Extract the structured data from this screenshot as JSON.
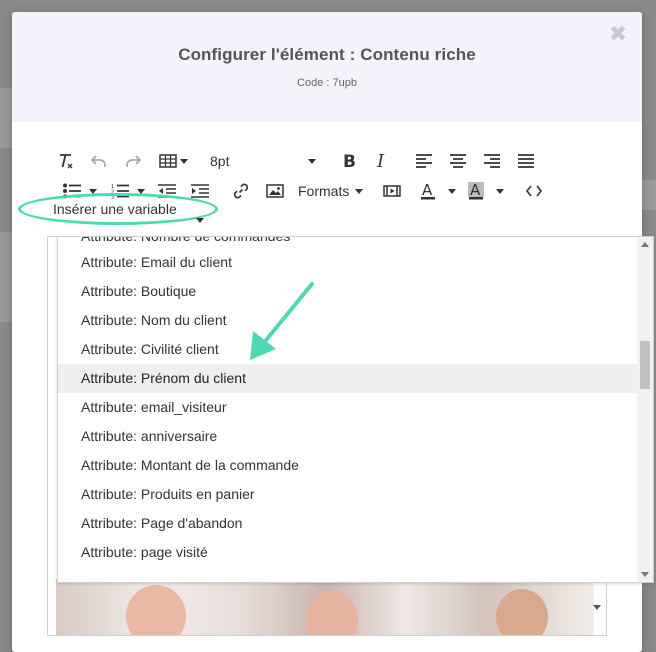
{
  "modal": {
    "title": "Configurer l'élément : Contenu riche",
    "code": "Code : 7upb",
    "close_glyph": "✖"
  },
  "toolbar": {
    "font_size": "8pt",
    "formats_label": "Formats",
    "insert_variable_label": "Insérer une variable",
    "icons": [
      "clear-format-icon",
      "undo-icon",
      "redo-icon",
      "table-icon",
      "bold-icon",
      "italic-icon",
      "align-left-icon",
      "align-center-icon",
      "align-right-icon",
      "align-justify-icon",
      "bullet-list-icon",
      "numbered-list-icon",
      "outdent-icon",
      "indent-icon",
      "link-icon",
      "image-icon",
      "media-icon",
      "text-color-icon",
      "background-color-icon",
      "source-code-icon"
    ],
    "text_color": "#333333",
    "bg_color": "#888888"
  },
  "dropdown": {
    "items": [
      {
        "label": "Attribute: Nombre de commandes"
      },
      {
        "label": "Attribute: Email du client"
      },
      {
        "label": "Attribute: Boutique"
      },
      {
        "label": "Attribute: Nom du client"
      },
      {
        "label": "Attribute: Civilité client"
      },
      {
        "label": "Attribute: Prénom du client"
      },
      {
        "label": "Attribute: email_visiteur"
      },
      {
        "label": "Attribute: anniversaire"
      },
      {
        "label": "Attribute: Montant de la commande"
      },
      {
        "label": "Attribute: Produits en panier"
      },
      {
        "label": "Attribute: Page d'abandon"
      },
      {
        "label": "Attribute: page visité"
      }
    ],
    "highlighted_index": 5
  },
  "colors": {
    "accent_highlight": "#4fd8b6",
    "header_bg": "#f4f2fb",
    "overlay": "#8a8a8a"
  }
}
